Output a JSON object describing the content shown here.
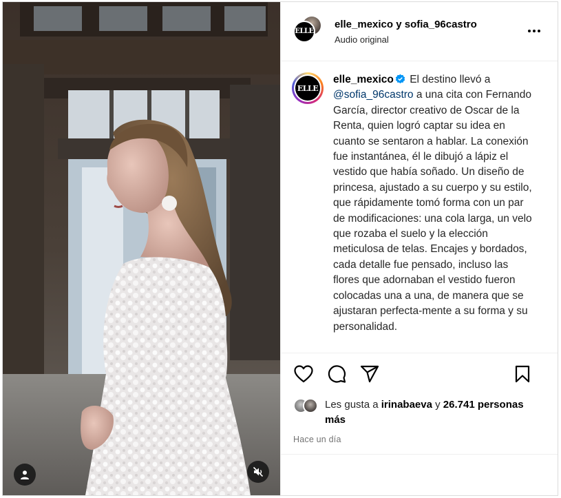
{
  "header": {
    "accounts": "elle_mexico y sofia_96castro",
    "audio": "Audio original",
    "avatar_logo": "ELLE"
  },
  "caption": {
    "username": "elle_mexico",
    "text_before_mention": "El destino llevó a",
    "mention": "@sofia_96castro",
    "text_after_mention": "a una cita con Fernando García, director creativo de Oscar de la Renta, quien logró captar su idea en cuanto se sentaron a hablar. La conexión fue instantánea, él le dibujó a lápiz el vestido que había soñado. Un diseño de princesa, ajustado a su cuerpo y su estilo, que rápidamente tomó forma con un par de modificaciones: una cola larga, un velo que rozaba el suelo y la elección meticulosa de telas. Encajes y bordados, cada detalle fue pensado, incluso las flores que adornaban el vestido fueron colocadas una a una, de manera que se ajustaran perfecta-mente a su forma y su personalidad."
  },
  "likes": {
    "prefix": "Les gusta a",
    "user": "irinabaeva",
    "connector": "y",
    "count": "26.741 personas más"
  },
  "timestamp": "Hace un día",
  "icons": {
    "like": "heart-icon",
    "comment": "comment-icon",
    "share": "send-icon",
    "save": "bookmark-icon",
    "more": "more-options-icon",
    "tag": "user-tag-icon",
    "mute": "muted-speaker-icon",
    "verified": "verified-badge-icon"
  },
  "colors": {
    "mention": "#00376b",
    "verified": "#0095f6",
    "muted_text": "#737373"
  }
}
